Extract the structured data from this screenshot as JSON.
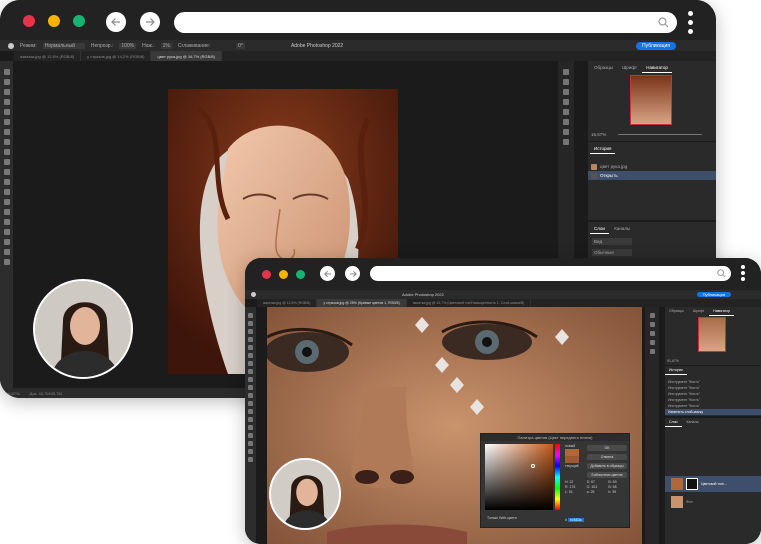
{
  "back_window": {
    "title": "Adobe Photoshop 2022",
    "menubar": {
      "mode_label": "Режим:",
      "mode_value": "Нормальный",
      "opacity_label": "Непрозр.:",
      "opacity_value": "100%",
      "flow_label": "Наж.:",
      "flow_value": "1%",
      "smoothing_label": "Сглаживание:",
      "angle_value": "0°",
      "share_label": "Публикация"
    },
    "tabs": [
      {
        "label": "азиатка.jpg @ 12,5% (RGB/8)"
      },
      {
        "label": "у стразов.jpg @ 14,2% (RGB/8)"
      },
      {
        "label": "цвет рука.jpg @ 16,7% (RGB/8)"
      }
    ],
    "panel_tabs": [
      "Образцы",
      "Шрифт",
      "Навигатор"
    ],
    "zoom_value": "16,67%",
    "history_title": "История",
    "history_items": [
      "цвет рука.jpg",
      "Открыть"
    ],
    "layers_tabs": [
      "Слои",
      "Каналы"
    ],
    "layers_filter": "Вид",
    "layers_mode": "Обычные",
    "status_zoom": "16,67%",
    "status_doc": "Док: 45,7M/45,7M"
  },
  "front_window": {
    "title": "Adobe Photoshop 2022",
    "share_label": "Публикация",
    "tabs": [
      {
        "label": "азиатка.jpg @ 12,5% (RGB/8)"
      },
      {
        "label": "у стразов.jpg @ 25% (Кривые цветов 1, RGB/8)"
      },
      {
        "label": "азиатка.jpg @ 16,7% (Цветовой тон/Насыщенность 1, Слой-маска/8)"
      }
    ],
    "panel_tabs": [
      "Образцы",
      "Шрифт",
      "Навигатор"
    ],
    "zoom_value": "91,67%",
    "history_title": "История",
    "history_items": [
      "Инструмент \"Кисть\"",
      "Инструмент \"Кисть\"",
      "Инструмент \"Кисть\"",
      "Инструмент \"Кисть\"",
      "Инструмент \"Кисть\"",
      "Изменить слой-маску"
    ],
    "layers_tabs": [
      "Слои",
      "Каналы"
    ],
    "layer_names": [
      "Цветовой тон/...",
      "Фон"
    ],
    "color_picker": {
      "title": "Палитра цветов (Цвет переднего плана)",
      "ok_label": "OK",
      "cancel_label": "Отмена",
      "add_label": "Добавить в образцы",
      "libraries_label": "Библиотеки цветов",
      "web_only_label": "Только Web-цвета",
      "new_label": "новый",
      "current_label": "текущий",
      "new_color": "#b0683a",
      "current_color": "#9b5a35",
      "hex_value": "b0683a",
      "values": [
        {
          "label": "H:",
          "value": "22"
        },
        {
          "label": "S:",
          "value": "67"
        },
        {
          "label": "B:",
          "value": "69"
        },
        {
          "label": "R:",
          "value": "176"
        },
        {
          "label": "G:",
          "value": "104"
        },
        {
          "label": "B:",
          "value": "58"
        },
        {
          "label": "L:",
          "value": "51"
        },
        {
          "label": "a:",
          "value": "25"
        },
        {
          "label": "b:",
          "value": "39"
        }
      ]
    }
  },
  "colors": {
    "traffic_red": "#e8334a",
    "traffic_yellow": "#f4b400",
    "traffic_green": "#16b372",
    "accent_blue": "#1473e6"
  },
  "icons": [
    "back-arrow-icon",
    "forward-arrow-icon",
    "search-icon",
    "more-vertical-icon"
  ]
}
